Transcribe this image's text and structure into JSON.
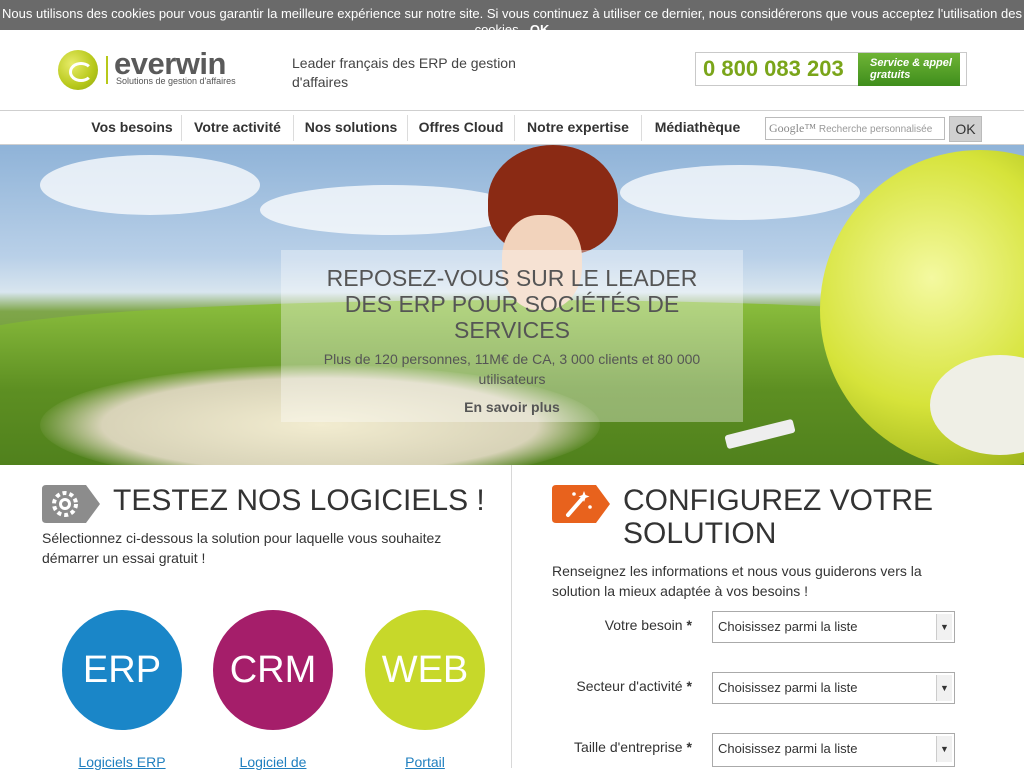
{
  "cookie": {
    "text": "Nous utilisons des cookies pour vous garantir la meilleure expérience sur notre site. Si vous continuez à utiliser ce dernier, nous considérerons que vous acceptez l'utilisation des cookies.",
    "ok": "OK"
  },
  "header": {
    "logo_word": "everwin",
    "logo_sub": "Solutions de gestion d'affaires",
    "tagline": "Leader français des ERP de gestion d'affaires",
    "phone": "0 800 083 203",
    "phone_badge": "Service & appel gratuits"
  },
  "nav": {
    "items": [
      "Vos besoins",
      "Votre activité",
      "Nos solutions",
      "Offres Cloud",
      "Notre expertise",
      "Médiathèque"
    ],
    "search_brand": "Google™",
    "search_placeholder": "Recherche personnalisée",
    "search_button": "OK"
  },
  "hero": {
    "title": "REPOSEZ-VOUS SUR LE LEADER DES ERP POUR SOCIÉTÉS DE SERVICES",
    "subtitle": "Plus de 120 personnes, 11M€ de CA, 3 000 clients et 80 000 utilisateurs",
    "link": "En savoir plus"
  },
  "test": {
    "title": "TESTEZ NOS LOGICIELS !",
    "desc": "Sélectionnez ci-dessous la solution pour laquelle vous souhaitez démarrer un essai gratuit !",
    "icon": "gear-icon",
    "circles": [
      {
        "label": "ERP",
        "caption": "Logiciels ERP",
        "color": "#1a86c8"
      },
      {
        "label": "CRM",
        "caption": "Logiciel de",
        "color": "#a51e6a"
      },
      {
        "label": "WEB",
        "caption": "Portail",
        "color": "#c7d82a"
      }
    ]
  },
  "config": {
    "title": "CONFIGUREZ VOTRE SOLUTION",
    "desc": "Renseignez les informations et nous vous guiderons vers la solution la mieux adaptée à vos besoins !",
    "icon": "magic-wand-icon",
    "accent": "#e8621d",
    "fields": [
      {
        "label": "Votre besoin",
        "value": "Choisissez parmi la liste"
      },
      {
        "label": "Secteur d'activité",
        "value": "Choisissez parmi la liste"
      },
      {
        "label": "Taille d'entreprise",
        "value": "Choisissez parmi la liste"
      }
    ],
    "required_mark": "*"
  }
}
